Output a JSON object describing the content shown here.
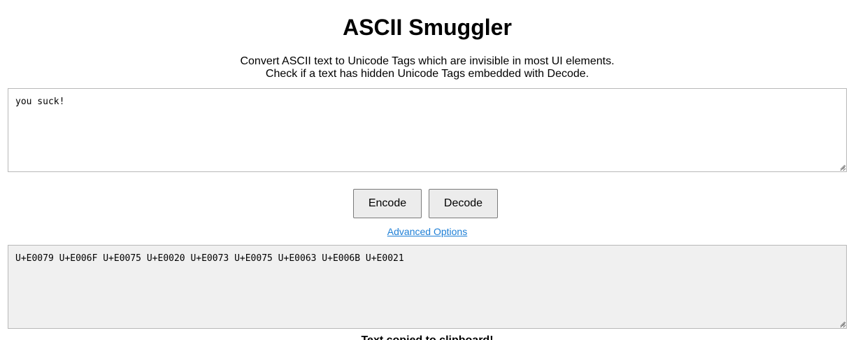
{
  "header": {
    "title": "ASCII Smuggler",
    "description_line1": "Convert ASCII text to Unicode Tags which are invisible in most UI elements.",
    "description_line2": "Check if a text has hidden Unicode Tags embedded with Decode."
  },
  "input": {
    "value": "you suck!"
  },
  "actions": {
    "encode_label": "Encode",
    "decode_label": "Decode",
    "advanced_label": "Advanced Options"
  },
  "output": {
    "value": "U+E0079 U+E006F U+E0075 U+E0020 U+E0073 U+E0075 U+E0063 U+E006B U+E0021"
  },
  "status": {
    "message": "Text copied to clipboard!"
  },
  "colors": {
    "link": "#1e7fd6",
    "output_background": "#f0f0f0",
    "button_background": "#ececec"
  }
}
